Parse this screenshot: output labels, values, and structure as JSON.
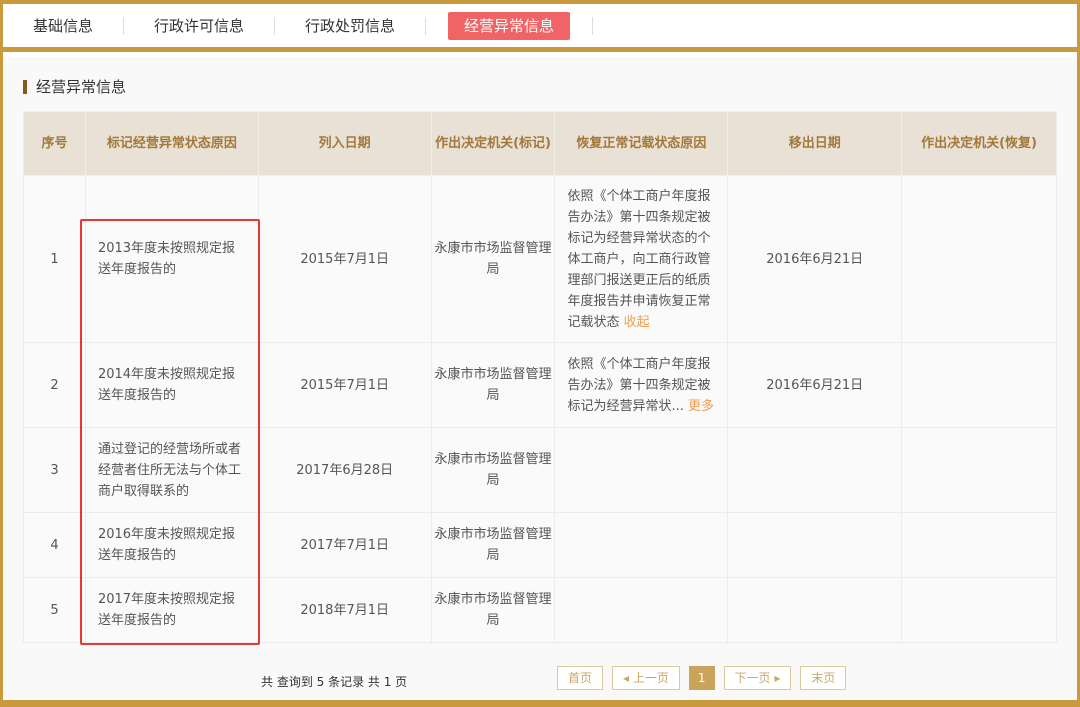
{
  "tabs": [
    "基础信息",
    "行政许可信息",
    "行政处罚信息",
    "经营异常信息"
  ],
  "section_title": "经营异常信息",
  "table": {
    "headers": [
      "序号",
      "标记经营异常状态原因",
      "列入日期",
      "作出决定机关(标记)",
      "恢复正常记载状态原因",
      "移出日期",
      "作出决定机关(恢复)"
    ],
    "rows": [
      {
        "no": "1",
        "reason": "2013年度未按照规定报送年度报告的",
        "date_in": "2015年7月1日",
        "org": "永康市市场监督管理局",
        "restore": "依照《个体工商户年度报告办法》第十四条规定被标记为经营异常状态的个体工商户，向工商行政管理部门报送更正后的纸质年度报告并申请恢复正常记载状态",
        "restore_link": "收起",
        "date_out": "2016年6月21日",
        "org_restore": ""
      },
      {
        "no": "2",
        "reason": "2014年度未按照规定报送年度报告的",
        "date_in": "2015年7月1日",
        "org": "永康市市场监督管理局",
        "restore": "依照《个体工商户年度报告办法》第十四条规定被标记为经营异常状...",
        "restore_link": "更多",
        "date_out": "2016年6月21日",
        "org_restore": ""
      },
      {
        "no": "3",
        "reason": "通过登记的经营场所或者经营者住所无法与个体工商户取得联系的",
        "date_in": "2017年6月28日",
        "org": "永康市市场监督管理局",
        "restore": "",
        "restore_link": "",
        "date_out": "",
        "org_restore": ""
      },
      {
        "no": "4",
        "reason": "2016年度未按照规定报送年度报告的",
        "date_in": "2017年7月1日",
        "org": "永康市市场监督管理局",
        "restore": "",
        "restore_link": "",
        "date_out": "",
        "org_restore": ""
      },
      {
        "no": "5",
        "reason": "2017年度未按照规定报送年度报告的",
        "date_in": "2018年7月1日",
        "org": "永康市市场监督管理局",
        "restore": "",
        "restore_link": "",
        "date_out": "",
        "org_restore": ""
      }
    ]
  },
  "footer": {
    "count": "共 查询到 5 条记录 共 1 页",
    "first": "首页",
    "prev": "◂ 上一页",
    "current": "1",
    "next": "下一页 ▸",
    "last": "末页"
  },
  "colors": {
    "gold": "#c99a3b",
    "active_tab": "#f06465",
    "highlight": "#e53935"
  }
}
